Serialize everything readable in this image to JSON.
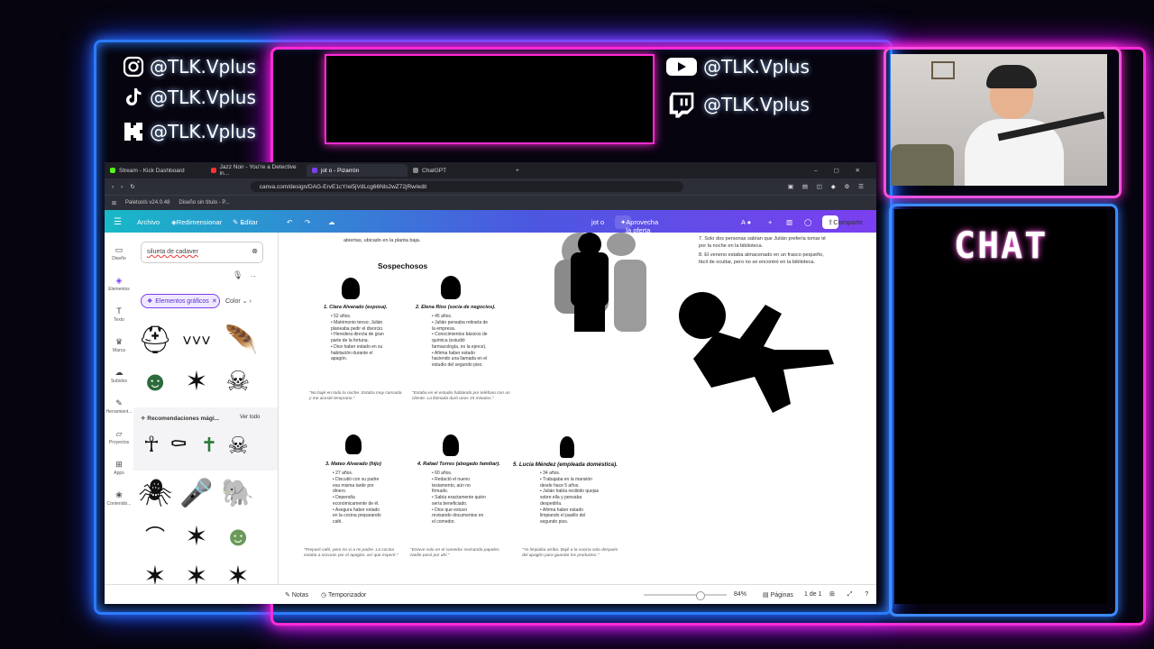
{
  "overlay": {
    "socials": [
      {
        "icon": "instagram-icon",
        "handle": "@TLK.Vplus"
      },
      {
        "icon": "tiktok-icon",
        "handle": "@TLK.Vplus"
      },
      {
        "icon": "kick-icon",
        "handle": "@TLK.Vplus"
      },
      {
        "icon": "youtube-icon",
        "handle": "@TLK.Vplus"
      },
      {
        "icon": "twitch-icon",
        "handle": "@TLK.Vplus"
      }
    ],
    "chat_title": "CHAT",
    "colors": {
      "blue_neon": "#2b7bff",
      "pink_neon": "#ff2bd6"
    }
  },
  "browser": {
    "tabs": [
      {
        "label": "Stream - Kick Dashboard",
        "color": "#53fc18"
      },
      {
        "label": "Jazz Noir - You're a Detective in...",
        "color": "#ff3030"
      },
      {
        "label": "jot o - Pizarrón",
        "color": "#7b3ff0",
        "active": true
      },
      {
        "label": "ChatGPT",
        "color": "#888888"
      }
    ],
    "url": "canva.com/design/DAG-ErvE1cY/ei5jVdLcg66Nls2wZ72jRw/edit",
    "bookmarks": [
      "Paletools v24.0.48",
      "Diseño sin título - P..."
    ]
  },
  "canva": {
    "menu": {
      "archivo": "Archivo",
      "redimensionar": "Redimensionar",
      "editar": "Editar"
    },
    "doc_title": "jot o",
    "promo": "Aprovecha la oferta para estudiantes",
    "share": "Compartir",
    "nav": [
      "Diseño",
      "Elementos",
      "Texto",
      "Marca",
      "Subidos",
      "Herramient...",
      "Proyectos",
      "Apps",
      "Contenido..."
    ],
    "search_value": "silueta de cadaver",
    "filter_chip": "Elementos gráficos",
    "filter_color": "Color",
    "recs_title": "Recomendaciones mági...",
    "recs_link": "Ver todo",
    "bottom": {
      "notes": "Notas",
      "timer": "Temporizador",
      "zoom": "84%",
      "pages_label": "Páginas",
      "page_count": "1 de 1"
    }
  },
  "document": {
    "intro_line": "abiertas, ubicado en la planta baja.",
    "section_title": "Sospechosos",
    "clues": [
      "7. Solo dos personas sabían que Julián prefería tomar té por la noche en la biblioteca.",
      "8. El veneno estaba almacenado en un frasco pequeño, fácil de ocultar, pero no se encontró en la biblioteca."
    ],
    "suspects": [
      {
        "name": "1. Clara Alvarado (esposa).",
        "facts": [
          "52 años.",
          "Matrimonio tenso; Julián planeaba pedir el divorcio.",
          "Heredera directa de gran parte de la fortuna.",
          "Dice haber estado en su habitación durante el apagón."
        ],
        "quote": "\"No bajé en toda la noche. Estaba muy cansada y me acosté temprano.\""
      },
      {
        "name": "2. Elena Ríos (socia de negocios).",
        "facts": [
          "45 años.",
          "Julián pensaba retirarla de la empresa.",
          "Conocimientos básicos de química (estudió farmacología, no la ejerce).",
          "Afirma haber estado haciendo una llamada en el estudio del segundo piso."
        ],
        "quote": "\"Estaba en el estudio hablando por teléfono con un cliente. La llamada duró unos 15 minutos.\""
      },
      {
        "name": "3. Mateo Alvarado (hijo)",
        "facts": [
          "27 años.",
          "Discutió con su padre esa misma tarde por dinero.",
          "Dependía económicamente de él.",
          "Asegura haber estado en la cocina preparando café."
        ],
        "quote": "\"Preparé café, pero no vi a mi padre. La cocina estaba a oscuras por el apagón, así que esperé.\""
      },
      {
        "name": "4. Rafael Torres (abogado familiar).",
        "facts": [
          "60 años.",
          "Redactó el nuevo testamento, aún no firmado.",
          "Sabía exactamente quién sería beneficiado.",
          "Dice que estuvo revisando documentos en el comedor."
        ],
        "quote": "\"Estuve solo en el comedor revisando papeles. Nadie pasó por ahí.\""
      },
      {
        "name": "5. Lucía Méndez (empleada doméstica).",
        "facts": [
          "34 años.",
          "Trabajaba en la mansión desde hace 5 años.",
          "Julián había recibido quejas sobre ella y pensaba despedirla.",
          "Afirma haber estado limpiando el pasillo del segundo piso."
        ],
        "quote": "\"Yo limpiaba arriba. Bajé a la cocina solo después del apagón para guardar los productos.\""
      }
    ]
  }
}
